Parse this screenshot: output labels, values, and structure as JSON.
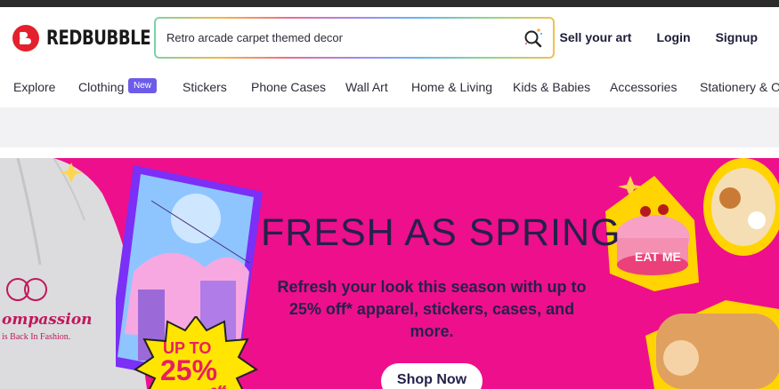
{
  "brand": {
    "name": "REDBUBBLE",
    "color": "#e4202c"
  },
  "search": {
    "value": "Retro arcade carpet themed decor",
    "icon": "search-icon"
  },
  "header_links": [
    "Sell your art",
    "Login",
    "Signup"
  ],
  "nav": {
    "items": [
      "Explore",
      "Clothing",
      "Stickers",
      "Phone Cases",
      "Wall Art",
      "Home & Living",
      "Kids & Babies",
      "Accessories",
      "Stationery & Of"
    ],
    "badge": "New"
  },
  "banner": {
    "headline": "FRESH AS SPRING",
    "subtext": "Refresh your look this season with up to 25% off* apparel, stickers, cases, and more.",
    "cta": "Shop Now",
    "background_color": "#ee0f8c",
    "hoodie_text_1": "ompassion",
    "hoodie_text_2": "is Back In Fashion.",
    "promo_1": "UP TO",
    "promo_2": "25%",
    "promo_3": "off",
    "cake_text": "EAT ME"
  }
}
